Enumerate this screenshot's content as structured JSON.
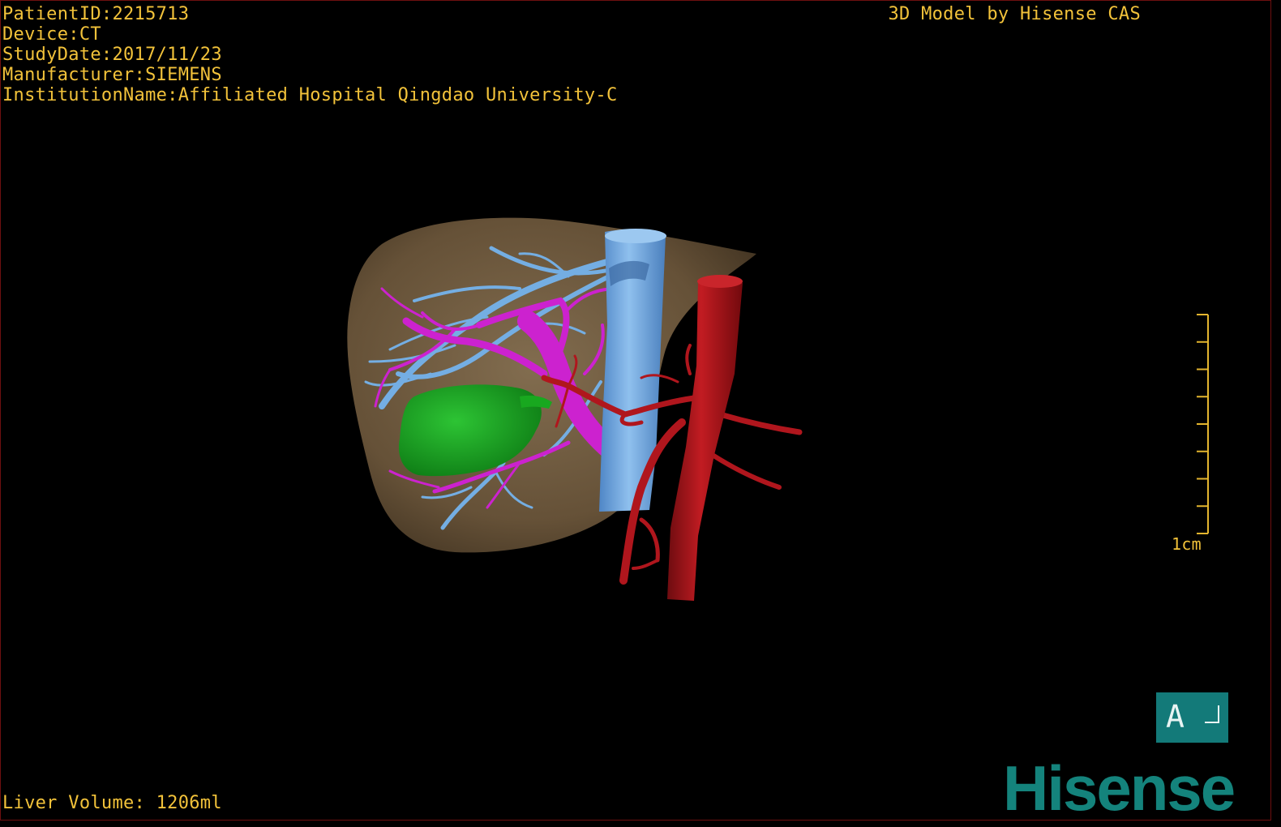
{
  "study_info": {
    "patient_id": "PatientID:2215713",
    "device": "Device:CT",
    "study_date": "StudyDate:2017/11/23",
    "manufacturer": "Manufacturer:SIEMENS",
    "institution": "InstitutionName:Affiliated Hospital Qingdao University-C"
  },
  "viewer_title": "3D Model by Hisense CAS",
  "liver_volume": "Liver Volume: 1206ml",
  "scale_bar": {
    "label": "1cm",
    "ticks": 9
  },
  "orientation": {
    "label": "A"
  },
  "brand": {
    "name": "Hisense",
    "color": "#14837c"
  },
  "colors": {
    "overlay_text": "#f2c23a",
    "liver": "#7a6446",
    "hepatic_vein": "#6fa6dd",
    "portal_vein": "#c71fc9",
    "artery": "#a0141a",
    "tumor": "#149a1b"
  }
}
